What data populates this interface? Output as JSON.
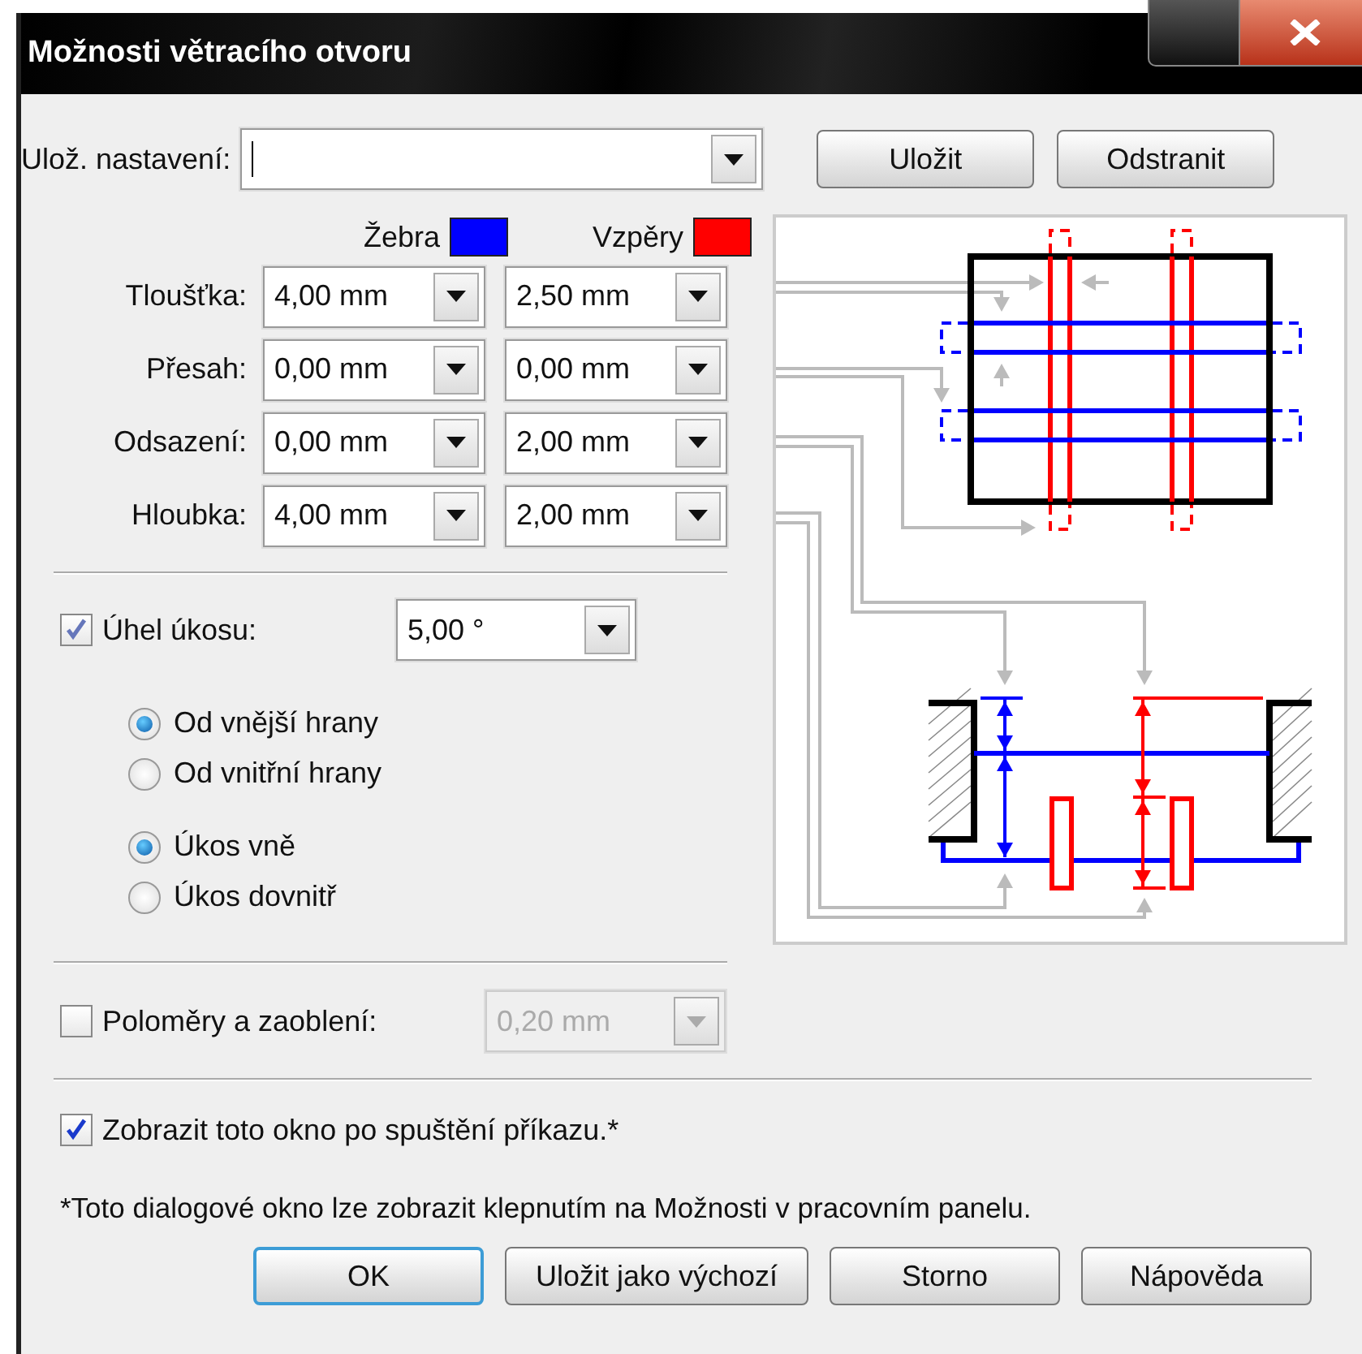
{
  "window": {
    "title": "Možnosti větracího otvoru"
  },
  "saved_settings": {
    "label": "Ulož. nastavení:"
  },
  "settings_buttons": [
    "Uložit",
    "Odstranit"
  ],
  "columns": [
    {
      "label": "Žebra",
      "color": "#0000ff"
    },
    {
      "label": "Vzpěry",
      "color": "#ff0000"
    }
  ],
  "rows": [
    {
      "label": "Tloušťka:",
      "values": [
        "4,00 mm",
        "2,50 mm"
      ]
    },
    {
      "label": "Přesah:",
      "values": [
        "0,00 mm",
        "0,00 mm"
      ]
    },
    {
      "label": "Odsazení:",
      "values": [
        "0,00 mm",
        "2,00 mm"
      ]
    },
    {
      "label": "Hloubka:",
      "values": [
        "4,00 mm",
        "2,00 mm"
      ]
    }
  ],
  "bevel": {
    "label": "Úhel úkosu:",
    "checked": true,
    "value": "5,00 °"
  },
  "edge_options": [
    {
      "label": "Od vnější hrany",
      "selected": true
    },
    {
      "label": "Od vnitřní hrany",
      "selected": false
    }
  ],
  "bevel_options": [
    {
      "label": "Úkos vně",
      "selected": true
    },
    {
      "label": "Úkos dovnitř",
      "selected": false
    }
  ],
  "radius": {
    "label": "Poloměry a zaoblení:",
    "checked": false,
    "value": "0,20 mm",
    "disabled": true
  },
  "show_on_start": {
    "label": "Zobrazit toto okno po spuštění příkazu.*",
    "checked": true
  },
  "footnote": "*Toto dialogové okno lze zobrazit klepnutím na Možnosti v pracovním panelu.",
  "buttons": [
    {
      "label": "OK",
      "default": true
    },
    {
      "label": "Uložit jako výchozí",
      "default": false
    },
    {
      "label": "Storno",
      "default": false
    },
    {
      "label": "Nápověda",
      "default": false
    }
  ]
}
